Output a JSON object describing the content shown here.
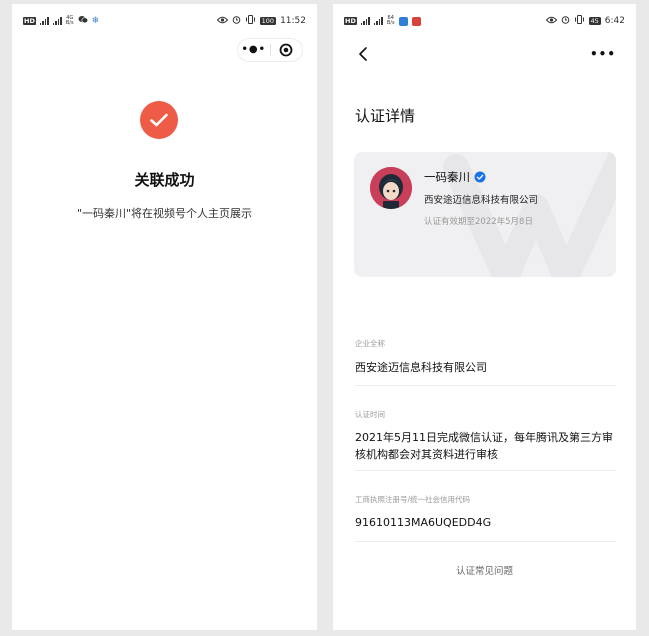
{
  "left": {
    "status": {
      "hd": "HD",
      "net_top": "4G",
      "net_bottom": "B/s",
      "battery": "100",
      "time": "11:52"
    },
    "capsule": {
      "more": "•●•"
    },
    "title": "关联成功",
    "description": "\"一码秦川\"将在视频号个人主页展示"
  },
  "right": {
    "status": {
      "hd": "HD",
      "net_top": "64",
      "net_bottom": "B/s",
      "battery": "45",
      "time": "6:42"
    },
    "nav": {
      "more": "•••"
    },
    "page_title": "认证详情",
    "card": {
      "name": "一码秦川",
      "company": "西安途迈信息科技有限公司",
      "validity": "认证有效期至2022年5月8日"
    },
    "fields": [
      {
        "label": "企业全称",
        "value": "西安途迈信息科技有限公司"
      },
      {
        "label": "认证时间",
        "value": "2021年5月11日完成微信认证，每年腾讯及第三方审核机构都会对其资料进行审核"
      },
      {
        "label": "工商执照注册号/统一社会信用代码",
        "value": "91610113MA6UQEDD4G"
      }
    ],
    "faq_link": "认证常见问题"
  },
  "colors": {
    "success": "#ee5c47",
    "verified": "#1a73e8",
    "card_bg": "#f0f0f2",
    "muted_text": "#9a9a9a"
  },
  "icons": [
    "hd-icon",
    "signal-icon",
    "wechat-icon",
    "snowflake-icon",
    "eye-icon",
    "alarm-icon",
    "vibrate-icon",
    "battery-icon",
    "more-dots-icon",
    "close-circle-icon",
    "check-icon",
    "back-arrow-icon",
    "verified-badge-icon"
  ]
}
